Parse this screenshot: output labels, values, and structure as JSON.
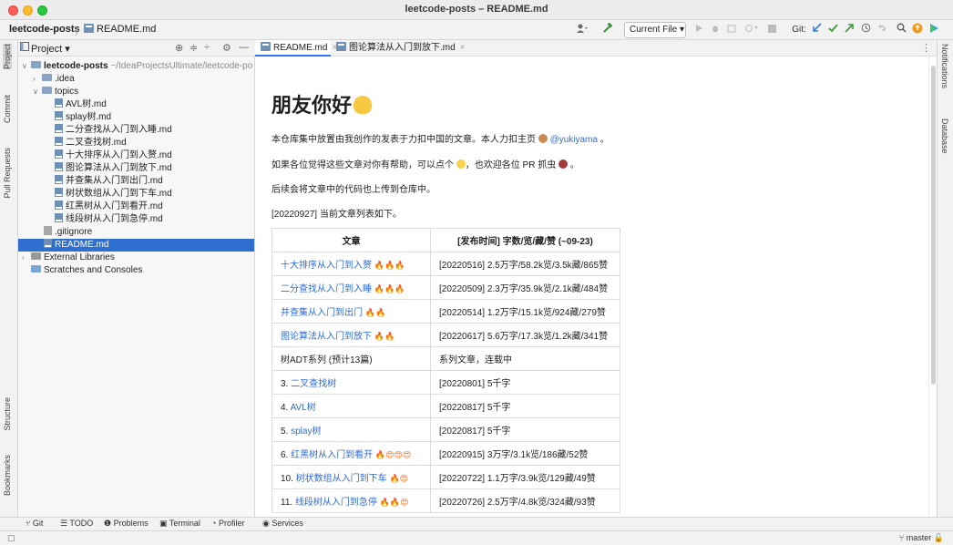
{
  "window": {
    "title": "leetcode-posts – README.md"
  },
  "breadcrumb": {
    "project": "leetcode-posts",
    "separator": "〉",
    "file": "README.md"
  },
  "toolbar": {
    "run_config": "Current File ▾",
    "git_label": "Git:",
    "icons": [
      "user-icon",
      "hammer-icon",
      "run-icon",
      "debug-icon",
      "coverage-icon",
      "more-run-icon",
      "stop-icon",
      "git-update-icon",
      "git-commit-icon",
      "git-push-icon",
      "history-icon",
      "rollback-icon",
      "search-icon",
      "update-icon",
      "ai-assistant-icon"
    ]
  },
  "left_stripe": {
    "tabs": [
      "Project",
      "Commit",
      "Pull Requests",
      "Structure",
      "Bookmarks"
    ]
  },
  "right_stripe": {
    "tabs": [
      "Notifications",
      "Database"
    ]
  },
  "project_panel": {
    "header": "Project ▾",
    "tree": [
      {
        "arrow": "∨",
        "label": "leetcode-posts",
        "hint": "~/IdeaProjectsUltimate/leetcode-po",
        "type": "folder",
        "bold": true
      },
      {
        "arrow": "›",
        "label": ".idea",
        "type": "folder"
      },
      {
        "arrow": "∨",
        "label": "topics",
        "type": "folder"
      },
      {
        "label": "AVL树.md",
        "type": "md"
      },
      {
        "label": "splay树.md",
        "type": "md"
      },
      {
        "label": "二分查找从入门到入睡.md",
        "type": "md"
      },
      {
        "label": "二叉查找树.md",
        "type": "md"
      },
      {
        "label": "十大排序从入门到入赘.md",
        "type": "md"
      },
      {
        "label": "图论算法从入门到放下.md",
        "type": "md"
      },
      {
        "label": "并查集从入门到出门.md",
        "type": "md"
      },
      {
        "label": "树状数组从入门到下车.md",
        "type": "md"
      },
      {
        "label": "红黑树从入门到看开.md",
        "type": "md"
      },
      {
        "label": "线段树从入门到急停.md",
        "type": "md"
      },
      {
        "label": ".gitignore",
        "type": "git"
      },
      {
        "label": "README.md",
        "type": "md",
        "selected": true
      },
      {
        "arrow": "›",
        "label": "External Libraries",
        "type": "lib"
      },
      {
        "label": "Scratches and Consoles",
        "type": "scratch"
      }
    ]
  },
  "tabs": [
    {
      "label": "README.md",
      "active": true
    },
    {
      "label": "图论算法从入门到放下.md",
      "active": false
    }
  ],
  "readme": {
    "title": "朋友你好",
    "p1_text": "本仓库集中放置由我创作的发表于力扣中国的文章。本人力扣主页",
    "p1_link": "@yukiyama",
    "p1_tail": "。",
    "p2": "如果各位觉得这些文章对你有帮助，可以点个",
    "p2_mid": "，也欢迎各位 PR 抓虫",
    "p2_tail": "。",
    "p3": "后续会将文章中的代码也上传到仓库中。",
    "p4": "[20220927] 当前文章列表如下。",
    "table": {
      "headers": [
        "文章",
        "[发布时间] 字数/览/藏/赞 (~09-23)"
      ],
      "rows": [
        {
          "title": "十大排序从入门到入赘",
          "link": true,
          "fire": "🔥🔥🔥",
          "stats": "[20220516] 2.5万字/58.2k览/3.5k藏/865赞"
        },
        {
          "title": "二分查找从入门到入睡",
          "link": true,
          "fire": "🔥🔥🔥",
          "stats": "[20220509] 2.3万字/35.9k览/2.1k藏/484赞"
        },
        {
          "title": "并查集从入门到出门",
          "link": true,
          "fire": "🔥🔥",
          "stats": "[20220514] 1.2万字/15.1k览/924藏/279赞"
        },
        {
          "title": "图论算法从入门到放下",
          "link": true,
          "fire": "🔥🔥",
          "stats": "[20220617] 5.6万字/17.3k览/1.2k藏/341赞"
        },
        {
          "title": "树ADT系列 (预计13篇)",
          "link": false,
          "fire": "",
          "stats": "系列文章，连载中"
        },
        {
          "prefix": "3. ",
          "title": "二叉查找树",
          "link": true,
          "fire": "",
          "stats": "[20220801] 5千字"
        },
        {
          "prefix": "4. ",
          "title": "AVL树",
          "link": true,
          "fire": "",
          "stats": "[20220817] 5千字"
        },
        {
          "prefix": "5. ",
          "title": "splay树",
          "link": true,
          "fire": "",
          "stats": "[20220817] 5千字"
        },
        {
          "prefix": "6. ",
          "title": "红黑树从入门到看开",
          "link": true,
          "fire": "🔥😍😍😍",
          "stats": "[20220915] 3万字/3.1k览/186藏/52赞"
        },
        {
          "prefix": "10. ",
          "title": "树状数组从入门到下车",
          "link": true,
          "fire": "🔥😍",
          "stats": "[20220722] 1.1万字/3.9k览/129藏/49赞"
        },
        {
          "prefix": "11. ",
          "title": "线段树从入门到急停",
          "link": true,
          "fire": "🔥🔥😍",
          "stats": "[20220726] 2.5万字/4.8k览/324藏/93赞"
        }
      ]
    }
  },
  "bottom_tools": [
    "Git",
    "TODO",
    "Problems",
    "Terminal",
    "Profiler",
    "Services"
  ],
  "status": {
    "branch": "master"
  },
  "colors": {
    "accent": "#3574f0",
    "link": "#2f6bd4",
    "selection": "#2f6fcf"
  }
}
